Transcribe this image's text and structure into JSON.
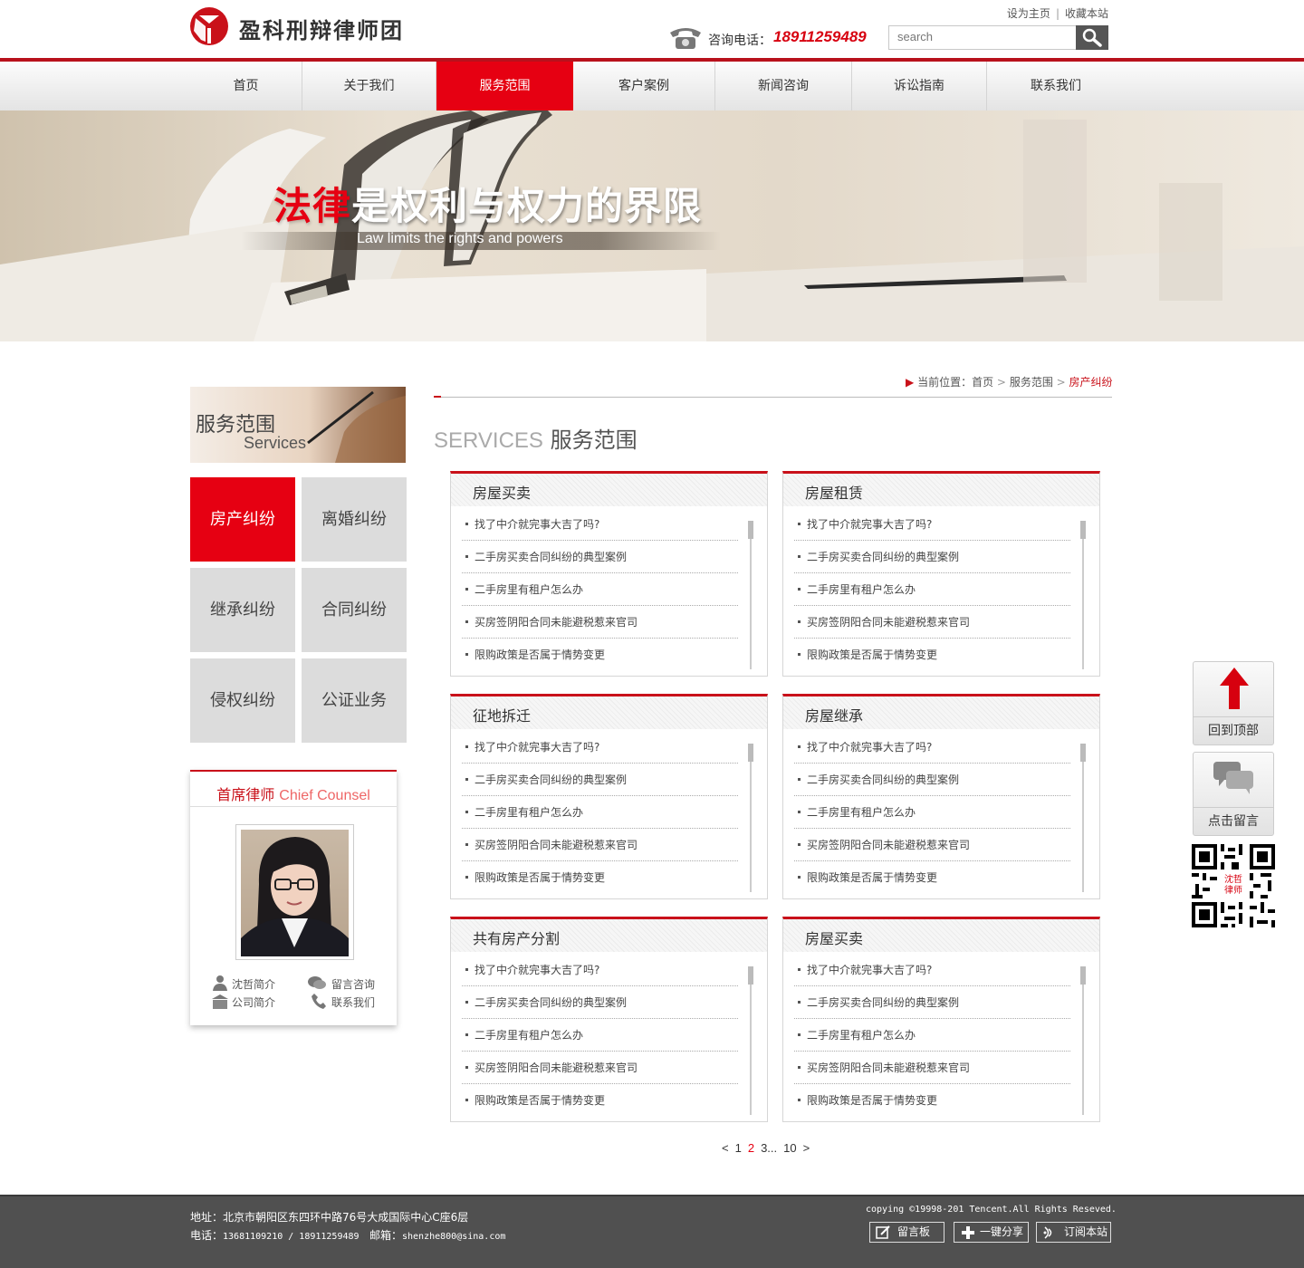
{
  "header": {
    "brand": "盈科刑辩律师团",
    "links": [
      "设为主页",
      "收藏本站"
    ],
    "phone_label": "咨询电话：",
    "phone_number": "18911259489",
    "search_placeholder": "search"
  },
  "nav": {
    "items": [
      "首页",
      "关于我们",
      "服务范围",
      "客户案例",
      "新闻咨询",
      "诉讼指南",
      "联系我们"
    ],
    "active_index": 2
  },
  "banner": {
    "title_red": "法律",
    "title_rest": "是权利与权力的界限",
    "subtitle": "Law limits the rights and powers"
  },
  "breadcrumb": {
    "prefix": "当前位置：",
    "items": [
      "首页",
      "服务范围"
    ],
    "current": "房产纠纷"
  },
  "section": {
    "title_en": "SERVICES",
    "title_cn": "服务范围"
  },
  "sidebar": {
    "head_cn": "服务范围",
    "head_en": "Services",
    "categories": [
      "房产纠纷",
      "离婚纠纷",
      "继承纠纷",
      "合同纠纷",
      "侵权纠纷",
      "公证业务"
    ],
    "active_index": 0
  },
  "counsel": {
    "title_cn": "首席律师",
    "title_en": "Chief Counsel",
    "links": [
      "沈哲简介",
      "留言咨询",
      "公司简介",
      "联系我们"
    ]
  },
  "boxes": [
    {
      "title": "房屋买卖",
      "items": [
        "找了中介就完事大吉了吗?",
        "二手房买卖合同纠纷的典型案例",
        "二手房里有租户怎么办",
        "买房签阴阳合同未能避税惹来官司",
        "限购政策是否属于情势变更"
      ]
    },
    {
      "title": "房屋租赁",
      "items": [
        "找了中介就完事大吉了吗?",
        "二手房买卖合同纠纷的典型案例",
        "二手房里有租户怎么办",
        "买房签阴阳合同未能避税惹来官司",
        "限购政策是否属于情势变更"
      ]
    },
    {
      "title": "征地拆迁",
      "items": [
        "找了中介就完事大吉了吗?",
        "二手房买卖合同纠纷的典型案例",
        "二手房里有租户怎么办",
        "买房签阴阳合同未能避税惹来官司",
        "限购政策是否属于情势变更"
      ]
    },
    {
      "title": "房屋继承",
      "items": [
        "找了中介就完事大吉了吗?",
        "二手房买卖合同纠纷的典型案例",
        "二手房里有租户怎么办",
        "买房签阴阳合同未能避税惹来官司",
        "限购政策是否属于情势变更"
      ]
    },
    {
      "title": "共有房产分割",
      "items": [
        "找了中介就完事大吉了吗?",
        "二手房买卖合同纠纷的典型案例",
        "二手房里有租户怎么办",
        "买房签阴阳合同未能避税惹来官司",
        "限购政策是否属于情势变更"
      ]
    },
    {
      "title": "房屋买卖",
      "items": [
        "找了中介就完事大吉了吗?",
        "二手房买卖合同纠纷的典型案例",
        "二手房里有租户怎么办",
        "买房签阴阳合同未能避税惹来官司",
        "限购政策是否属于情势变更"
      ]
    }
  ],
  "pager": {
    "prev": "<",
    "pages": [
      "1",
      "2",
      "3"
    ],
    "ellipsis": "...",
    "last": "10",
    "next": ">",
    "current": "2"
  },
  "float": {
    "top_label": "回到顶部",
    "message_label": "点击留言",
    "qr_text": "沈哲律师"
  },
  "footer": {
    "address": "地址：北京市朝阳区东四环中路76号大成国际中心C座6层",
    "phone_label": "电话：",
    "phones": "13681109210 / 18911259489",
    "email_label": "邮箱：",
    "email": "shenzhe800@sina.com",
    "copyright": "copying ©19998-201 Tencent.All Rights Reseved.",
    "buttons": [
      "留言板",
      "一键分享",
      "订阅本站"
    ]
  },
  "colors": {
    "brand_red": "#e60012",
    "dark_red": "#c9111a",
    "footer_bg": "#505050"
  }
}
